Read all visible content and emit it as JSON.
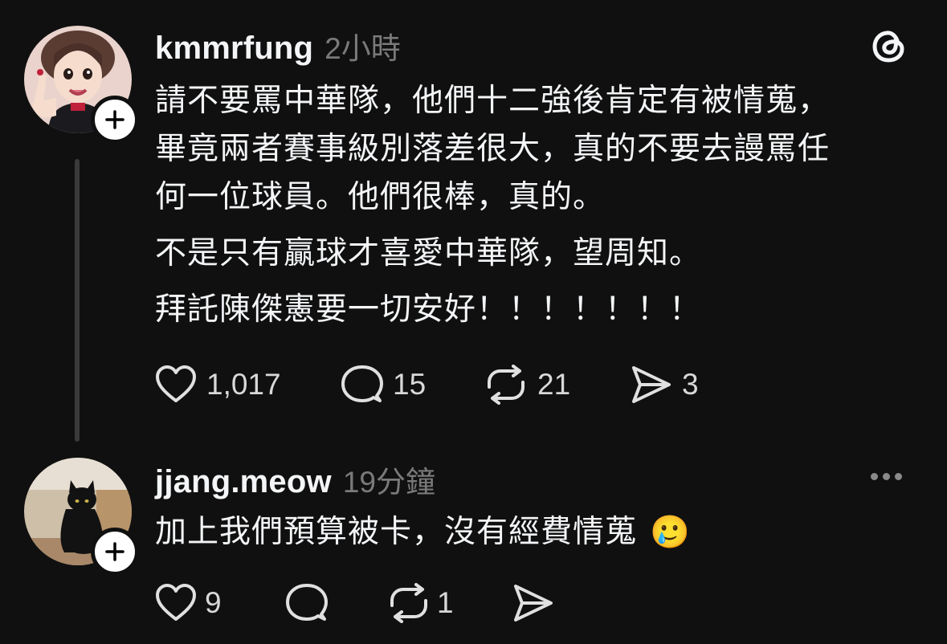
{
  "colors": {
    "background": "#101010",
    "text": "#f3f5f7",
    "muted": "#7a7a7a",
    "thread_line": "#3a3a3a"
  },
  "posts": [
    {
      "username": "kmmrfung",
      "time": "2小時",
      "avatar_icon": "illustrated-girl-avatar",
      "follow_icon": "plus-icon",
      "top_right_icon": "threads-logo-icon",
      "paragraphs": [
        "請不要罵中華隊，他們十二強後肯定有被情蒐，",
        "畢竟兩者賽事級別落差很大，真的不要去謾罵任",
        "何一位球員。他們很棒，真的。",
        "不是只有贏球才喜愛中華隊，望周知。",
        "拜託陳傑憲要一切安好！！！！！！！"
      ],
      "actions": {
        "like_icon": "heart-icon",
        "likes": "1,017",
        "reply_icon": "comment-icon",
        "replies": "15",
        "repost_icon": "repost-icon",
        "reposts": "21",
        "share_icon": "send-icon",
        "shares": "3"
      }
    },
    {
      "username": "jjang.meow",
      "time": "19分鐘",
      "avatar_icon": "black-cat-avatar",
      "follow_icon": "plus-icon",
      "top_right_icon": "more-options-icon",
      "text": "加上我們預算被卡，沒有經費情蒐",
      "emoji": "🥲",
      "emoji_icon": "crying-face-emoji",
      "actions": {
        "like_icon": "heart-icon",
        "likes": "9",
        "reply_icon": "comment-icon",
        "repost_icon": "repost-icon",
        "reposts": "1",
        "share_icon": "send-icon"
      }
    }
  ]
}
